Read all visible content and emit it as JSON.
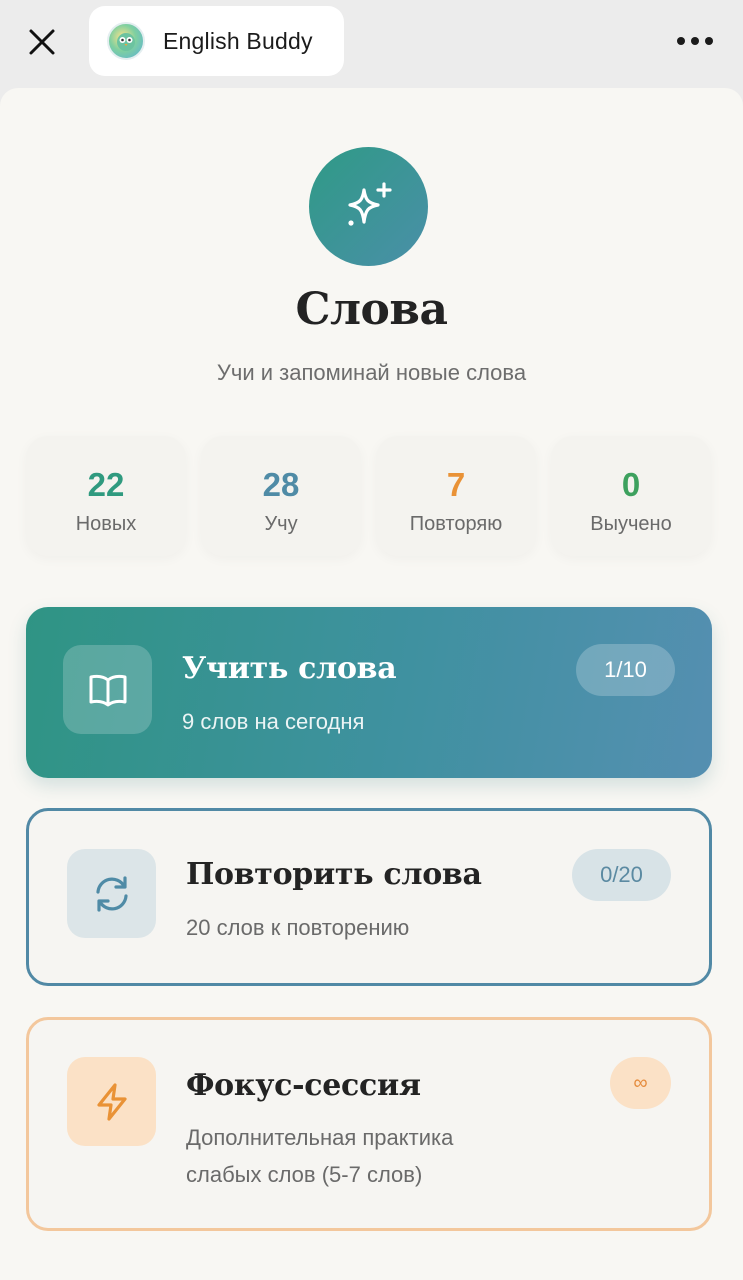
{
  "app": {
    "title": "English Buddy",
    "close_icon": "close-icon",
    "more_icon": "more-dots-icon"
  },
  "header": {
    "icon": "sparkles-icon",
    "title": "Слова",
    "subtitle": "Учи и запоминай новые слова"
  },
  "stats": [
    {
      "value": "22",
      "label": "Новых",
      "color": "#2f9a7f"
    },
    {
      "value": "28",
      "label": "Учу",
      "color": "#4f8ba6"
    },
    {
      "value": "7",
      "label": "Повторяю",
      "color": "#e99236"
    },
    {
      "value": "0",
      "label": "Выучено",
      "color": "#3da15e"
    }
  ],
  "cards": {
    "learn": {
      "icon": "book-open-icon",
      "title": "Учить слова",
      "subtitle": "9 слов на сегодня",
      "badge": "1/10"
    },
    "review": {
      "icon": "refresh-icon",
      "title": "Повторить слова",
      "subtitle": "20 слов к повторению",
      "badge": "0/20"
    },
    "focus": {
      "icon": "lightning-icon",
      "title": "Фокус-сессия",
      "subtitle_line1": "Дополнительная практика",
      "subtitle_line2": "слабых слов (5-7 слов)",
      "badge": "∞"
    }
  },
  "colors": {
    "accent_teal": "#2f9a86",
    "accent_blue": "#5189a5",
    "accent_orange": "#f3c79c",
    "background": "#f8f7f3"
  }
}
